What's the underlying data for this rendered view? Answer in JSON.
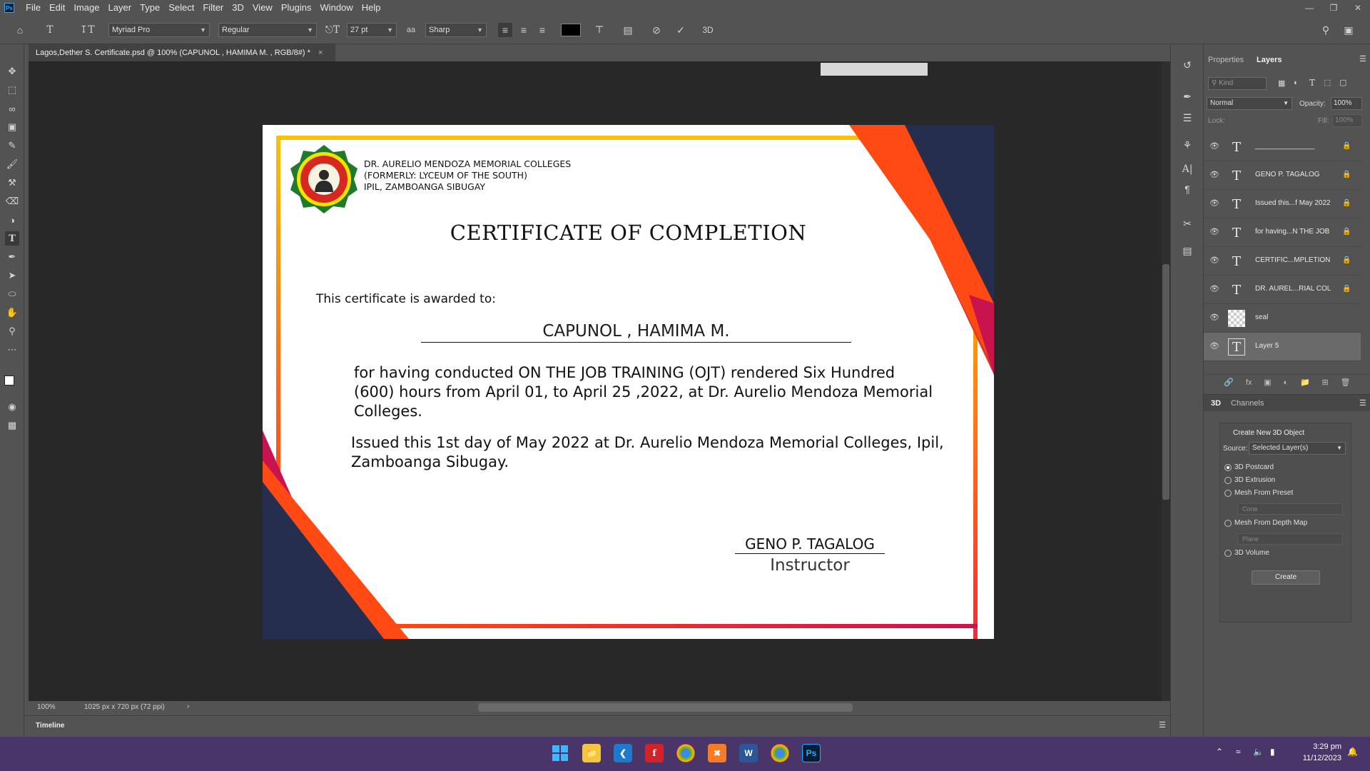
{
  "menubar": {
    "logo": "Ps",
    "items": [
      "File",
      "Edit",
      "Image",
      "Layer",
      "Type",
      "Select",
      "Filter",
      "3D",
      "View",
      "Plugins",
      "Window",
      "Help"
    ]
  },
  "options": {
    "font_family": "Myriad Pro",
    "font_style": "Regular",
    "font_size": "27 pt",
    "antialias": "Sharp",
    "color": "#000000",
    "three_d": "3D"
  },
  "document": {
    "tab_title": "Lagos,Dether S. Certificate.psd @ 100% (CAPUNOL , HAMIMA M. , RGB/8#) *",
    "zoom": "100%",
    "doc_size": "1025 px x 720 px (72 ppi)",
    "timeline": "Timeline"
  },
  "certificate": {
    "school_line1": "DR. AURELIO MENDOZA MEMORIAL COLLEGES",
    "school_line2": "(FORMERLY: LYCEUM OF THE SOUTH)",
    "school_line3": "IPIL, ZAMBOANGA SIBUGAY",
    "title": "CERTIFICATE OF COMPLETION",
    "awarded": "This certificate is awarded to:",
    "name": "CAPUNOL , HAMIMA M.",
    "body1": "for having conducted ON THE JOB TRAINING (OJT) rendered Six Hundred (600) hours from April 01, to April 25 ,2022, at Dr. Aurelio Mendoza Memorial Colleges.",
    "body2": "Issued this 1st day of May 2022 at Dr. Aurelio Mendoza Memorial Colleges, Ipil, Zamboanga Sibugay.",
    "signer": "GENO P. TAGALOG",
    "role": "Instructor"
  },
  "panels": {
    "tab_properties": "Properties",
    "tab_layers": "Layers",
    "search_placeholder": "Kind",
    "blend_mode": "Normal",
    "opacity_label": "Opacity:",
    "opacity_value": "100%",
    "lock_label": "Lock:",
    "fill_label": "Fill:",
    "fill_value": "100%",
    "layers": [
      {
        "name": "_______________",
        "kind": "text"
      },
      {
        "name": "GENO P. TAGALOG",
        "kind": "text"
      },
      {
        "name": "Issued this...f May 2022",
        "kind": "text"
      },
      {
        "name": "for having...N THE JOB",
        "kind": "text"
      },
      {
        "name": "CERTIFIC...MPLETION",
        "kind": "text"
      },
      {
        "name": "DR. AUREL...RIAL COL",
        "kind": "text"
      },
      {
        "name": "seal",
        "kind": "image"
      },
      {
        "name": "Layer 5",
        "kind": "text"
      }
    ],
    "tab_3d": "3D",
    "tab_channels": "Channels",
    "create_title": "Create New 3D Object",
    "source_label": "Source:",
    "source_value": "Selected Layer(s)",
    "options": [
      "3D Postcard",
      "3D Extrusion",
      "Mesh From Preset",
      "Mesh From Depth Map",
      "3D Volume"
    ],
    "preset_value": "Cone",
    "depth_value": "Plane",
    "create_button": "Create"
  },
  "taskbar": {
    "time": "3:29 pm",
    "date": "11/12/2023"
  },
  "colors": {
    "navy": "#262e4f",
    "orange": "#ff4a14",
    "crimson": "#c8134f",
    "gold": "#f7c20a",
    "ps_bg": "#535353",
    "canvas_bg": "#282828",
    "taskbar": "#4a3568"
  }
}
